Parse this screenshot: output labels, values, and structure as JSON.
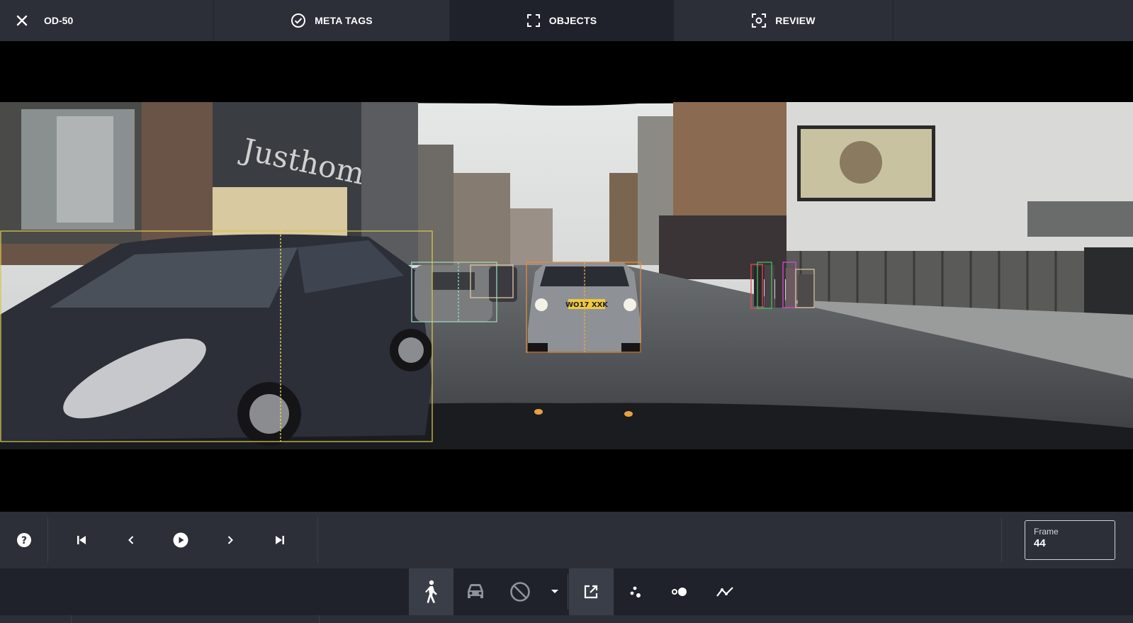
{
  "header": {
    "task_id": "OD-50",
    "tabs": [
      {
        "label": "META TAGS",
        "icon": "check-circle-icon"
      },
      {
        "label": "OBJECTS",
        "icon": "fullscreen-frame-icon"
      },
      {
        "label": "REVIEW",
        "icon": "focus-frame-icon"
      }
    ],
    "active_tab": "OBJECTS"
  },
  "scene": {
    "plate_text": "WO17 XXK",
    "annotations": [
      {
        "class": "vehicle",
        "color": "#d9c44a"
      },
      {
        "class": "vehicle",
        "color": "#9fd4b8"
      },
      {
        "class": "vehicle",
        "color": "#e0c9a0"
      },
      {
        "class": "vehicle",
        "color": "#e08a3c"
      },
      {
        "class": "pedestrian",
        "color": "#e04a5a"
      },
      {
        "class": "pedestrian",
        "color": "#3fbf5a"
      },
      {
        "class": "pedestrian",
        "color": "#d94ad0"
      },
      {
        "class": "pedestrian",
        "color": "#d9c4a0"
      }
    ]
  },
  "playback": {
    "frame_label": "Frame",
    "frame_value": "44"
  },
  "tools": [
    {
      "icon": "pedestrian-icon",
      "active": true
    },
    {
      "icon": "car-icon",
      "active": false
    },
    {
      "icon": "ignore-icon",
      "active": false
    },
    {
      "icon": "dropdown-arrow-icon",
      "active": false
    },
    {
      "icon": "open-external-icon",
      "active": true
    },
    {
      "icon": "keypoints-icon",
      "active": false
    },
    {
      "icon": "point-circle-icon",
      "active": false
    },
    {
      "icon": "polyline-icon",
      "active": false
    }
  ],
  "colors": {
    "topbar": "#2c2f38",
    "active_tab": "#1f222a",
    "toolbar": "#1f222a",
    "active_tool": "#3a3e48"
  }
}
